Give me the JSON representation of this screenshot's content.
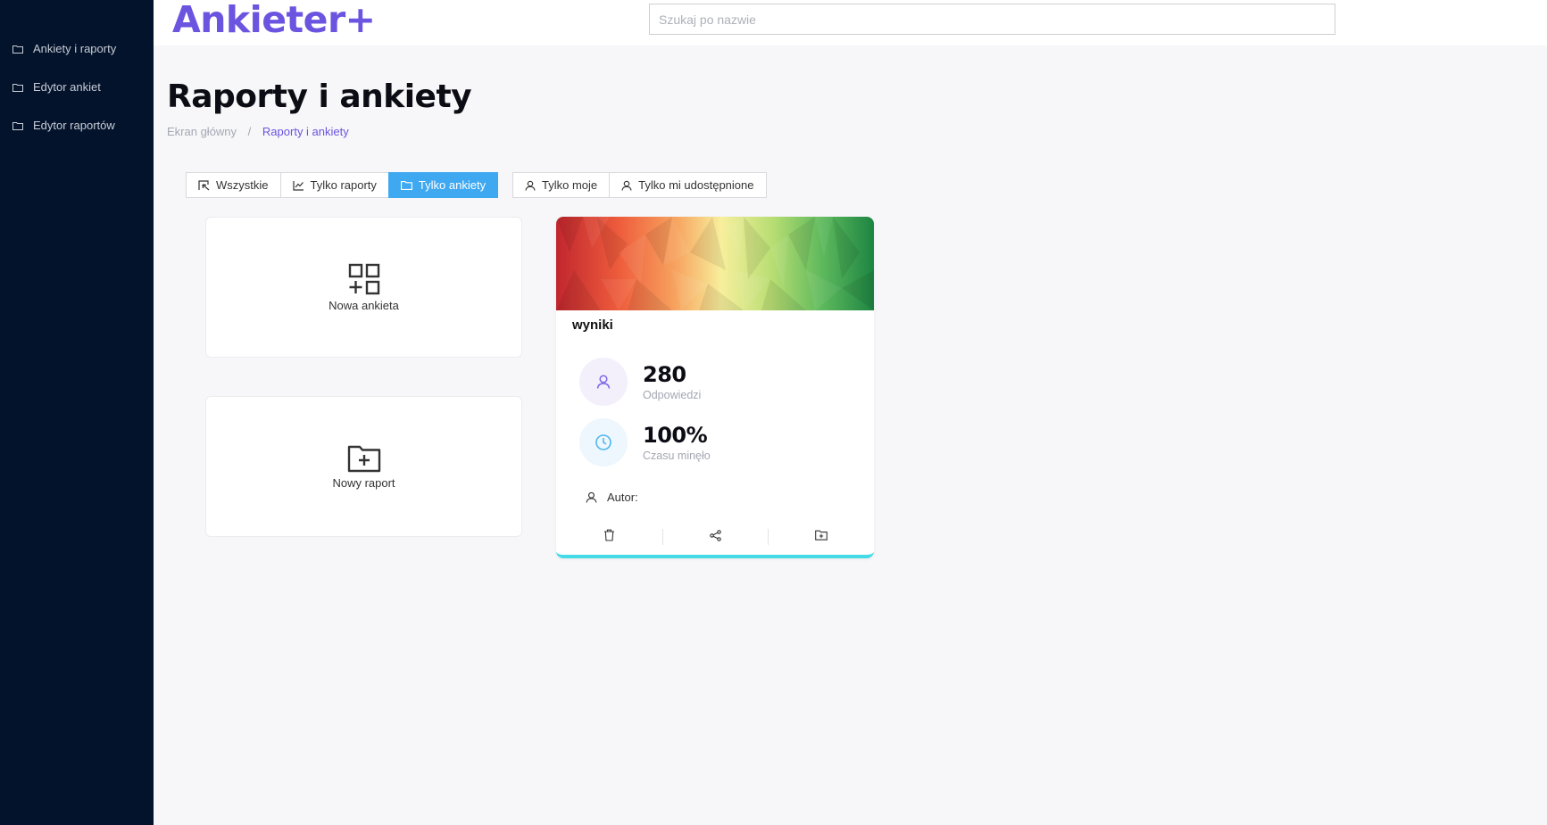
{
  "app": {
    "logo_text": "Ankieter+"
  },
  "sidebar": {
    "items": [
      {
        "label": "Ankiety i raporty",
        "icon": "folder-icon"
      },
      {
        "label": "Edytor ankiet",
        "icon": "folder-icon"
      },
      {
        "label": "Edytor raportów",
        "icon": "folder-icon"
      }
    ]
  },
  "search": {
    "placeholder": "Szukaj po nazwie",
    "value": ""
  },
  "page": {
    "title": "Raporty i ankiety"
  },
  "breadcrumb": {
    "home": "Ekran główny",
    "separator": "/",
    "current": "Raporty i ankiety"
  },
  "filters": {
    "type": [
      {
        "label": "Wszystkie",
        "icon": "select-all-icon",
        "active": false
      },
      {
        "label": "Tylko raporty",
        "icon": "chart-line-icon",
        "active": false
      },
      {
        "label": "Tylko ankiety",
        "icon": "folder-icon",
        "active": true
      }
    ],
    "owner": [
      {
        "label": "Tylko moje",
        "icon": "user-icon",
        "active": false
      },
      {
        "label": "Tylko mi udostępnione",
        "icon": "user-icon",
        "active": false
      }
    ]
  },
  "actions": {
    "new_survey": "Nowa ankieta",
    "new_report": "Nowy raport"
  },
  "survey_card": {
    "title": "wyniki",
    "responses_value": "280",
    "responses_label": "Odpowiedzi",
    "time_value": "100%",
    "time_label": "Czasu minęło",
    "author_label": "Autor:",
    "actions": [
      "trash-icon",
      "share-icon",
      "folder-plus-icon"
    ]
  },
  "colors": {
    "sidebar_bg": "#03132b",
    "accent": "#6a54e0",
    "active_filter": "#3ea8f1",
    "card_border_bottom": "#45dbe6",
    "responses_icon_bg": "#f3f0fc",
    "time_icon_bg": "#eef7fd"
  }
}
